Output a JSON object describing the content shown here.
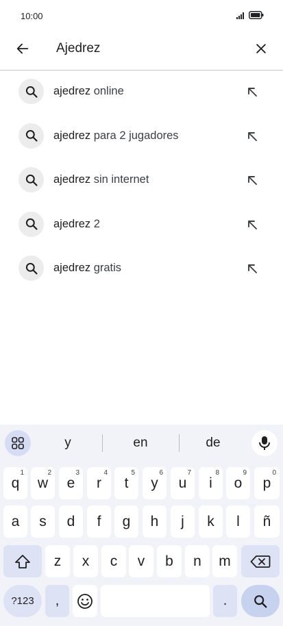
{
  "status": {
    "time": "10:00",
    "icons": [
      "signal-icon",
      "battery-icon"
    ]
  },
  "search": {
    "value": "Ajedrez",
    "back_icon": "arrow-left-icon",
    "clear_icon": "close-icon"
  },
  "suggestions": [
    {
      "prefix": "ajedrez",
      "rest": " online"
    },
    {
      "prefix": "ajedrez",
      "rest": " para 2 jugadores"
    },
    {
      "prefix": "ajedrez",
      "rest": " sin internet"
    },
    {
      "prefix": "ajedrez",
      "rest": " 2"
    },
    {
      "prefix": "ajedrez",
      "rest": " gratis"
    }
  ],
  "keyboard": {
    "word_suggestions": [
      "y",
      "en",
      "de"
    ],
    "row1": [
      {
        "key": "q",
        "hint": "1"
      },
      {
        "key": "w",
        "hint": "2"
      },
      {
        "key": "e",
        "hint": "3"
      },
      {
        "key": "r",
        "hint": "4"
      },
      {
        "key": "t",
        "hint": "5"
      },
      {
        "key": "y",
        "hint": "6"
      },
      {
        "key": "u",
        "hint": "7"
      },
      {
        "key": "i",
        "hint": "8"
      },
      {
        "key": "o",
        "hint": "9"
      },
      {
        "key": "p",
        "hint": "0"
      }
    ],
    "row2": [
      "a",
      "s",
      "d",
      "f",
      "g",
      "h",
      "j",
      "k",
      "l",
      "ñ"
    ],
    "row3": [
      "z",
      "x",
      "c",
      "v",
      "b",
      "n",
      "m"
    ],
    "symbols_label": "?123",
    "comma_label": ",",
    "period_label": ".",
    "colors": {
      "background": "#f1f3f8",
      "function_key": "#dde3f4",
      "enter_key": "#c7d2ef"
    }
  }
}
